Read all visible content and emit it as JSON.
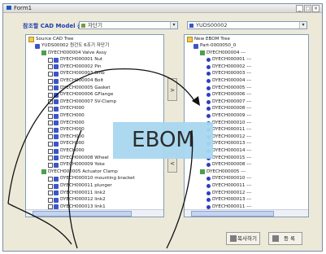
{
  "window": {
    "title": "Form1"
  },
  "header": {
    "label": "참조할 CAD Model 선택",
    "left_combo": "자단기",
    "right_combo": "YUDS00002"
  },
  "left_tree": {
    "root": "Source CAD Tree",
    "rows": [
      {
        "text": "YUDS00002  원건도 6조기  자단기",
        "level": 1,
        "icon": "part"
      },
      {
        "text": "DYECH000004  Valve Assy",
        "level": 2,
        "icon": "tree"
      },
      {
        "text": "DYECH000001  Nut",
        "level": 3,
        "icon": "part"
      },
      {
        "text": "DYECH000002  Pin",
        "level": 3,
        "icon": "part"
      },
      {
        "text": "DYECH000003  Blnb",
        "level": 3,
        "icon": "part"
      },
      {
        "text": "DYECH000004  Bolt",
        "level": 3,
        "icon": "part"
      },
      {
        "text": "DYECH000005  Gasket",
        "level": 3,
        "icon": "part"
      },
      {
        "text": "DYECH000006  GFlange",
        "level": 3,
        "icon": "part"
      },
      {
        "text": "DYECH000007  SV-Clamp",
        "level": 3,
        "icon": "part"
      },
      {
        "text": "DYECH000",
        "level": 3,
        "icon": "part"
      },
      {
        "text": "DYECH000",
        "level": 3,
        "icon": "part"
      },
      {
        "text": "DYECH000",
        "level": 3,
        "icon": "part"
      },
      {
        "text": "DYECH000",
        "level": 3,
        "icon": "part"
      },
      {
        "text": "DYECH000",
        "level": 3,
        "icon": "part"
      },
      {
        "text": "DYECH000",
        "level": 3,
        "icon": "part"
      },
      {
        "text": "DYECH000",
        "level": 3,
        "icon": "part"
      },
      {
        "text": "DYECH000008  Wheel",
        "level": 3,
        "icon": "part"
      },
      {
        "text": "DYECH000009  Yoke",
        "level": 3,
        "icon": "part"
      },
      {
        "text": "DYECH000005  Actuator Clamp",
        "level": 2,
        "icon": "tree"
      },
      {
        "text": "DYECH000010  mounting bracket",
        "level": 3,
        "icon": "part"
      },
      {
        "text": "DYECH000011  plunger",
        "level": 3,
        "icon": "part"
      },
      {
        "text": "DYECH000011  link2",
        "level": 3,
        "icon": "part"
      },
      {
        "text": "DYECH000012  link2",
        "level": 3,
        "icon": "part"
      },
      {
        "text": "DYECH000013  link1",
        "level": 3,
        "icon": "part"
      }
    ]
  },
  "right_tree": {
    "root": "New EBOM Tree",
    "rows": [
      {
        "text": "Part-0000050_0",
        "level": 1,
        "icon": "part"
      },
      {
        "text": "DYECH000004 ---",
        "level": 2,
        "icon": "tree"
      },
      {
        "text": "DYECH000001 ---",
        "level": 3,
        "icon": "dot"
      },
      {
        "text": "DYECH000002 ---",
        "level": 3,
        "icon": "dot"
      },
      {
        "text": "DYECH000003 ---",
        "level": 3,
        "icon": "dot"
      },
      {
        "text": "DYECH000004 ---",
        "level": 3,
        "icon": "dot"
      },
      {
        "text": "DYECH000005 ---",
        "level": 3,
        "icon": "dot"
      },
      {
        "text": "DYECH000006 ---",
        "level": 3,
        "icon": "dot"
      },
      {
        "text": "DYECH000007 ---",
        "level": 3,
        "icon": "dot"
      },
      {
        "text": "DYECH000008 ---",
        "level": 3,
        "icon": "dot"
      },
      {
        "text": "DYECH000009 ---",
        "level": 3,
        "icon": "dot"
      },
      {
        "text": "DYECH000010 ---",
        "level": 3,
        "icon": "dot"
      },
      {
        "text": "DYECH000011 ---",
        "level": 3,
        "icon": "dot"
      },
      {
        "text": "DYECH000012 ---",
        "level": 3,
        "icon": "dot"
      },
      {
        "text": "DYECH000013 ---",
        "level": 3,
        "icon": "dot"
      },
      {
        "text": "DYECH000014 ---",
        "level": 3,
        "icon": "dot"
      },
      {
        "text": "DYECH000015 ---",
        "level": 3,
        "icon": "dot"
      },
      {
        "text": "DYECH000008 ---",
        "level": 3,
        "icon": "dot"
      },
      {
        "text": "DYECH000005 ---",
        "level": 2,
        "icon": "tree"
      },
      {
        "text": "DYECH000010 ---",
        "level": 3,
        "icon": "dot"
      },
      {
        "text": "DYECH000011 ---",
        "level": 3,
        "icon": "dot"
      },
      {
        "text": "DYECH000012 ---",
        "level": 3,
        "icon": "dot"
      },
      {
        "text": "DYECH000013 ---",
        "level": 3,
        "icon": "dot"
      },
      {
        "text": "DYECH000011 ---",
        "level": 3,
        "icon": "dot"
      }
    ]
  },
  "buttons": {
    "add": ">",
    "remove": "<",
    "refresh_label": "복사하기",
    "save_label": "등 록"
  },
  "overlay": {
    "text": "EBOM"
  },
  "colors": {
    "accent": "#1b3fb0",
    "overlay_bg": "#a8d8f0"
  }
}
